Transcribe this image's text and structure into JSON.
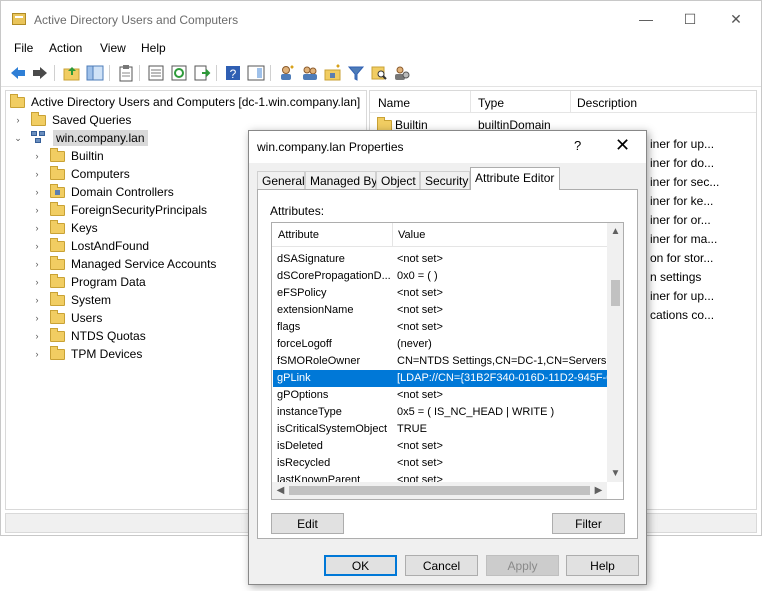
{
  "window": {
    "title": "Active Directory Users and Computers",
    "minimize": "—",
    "maximize": "☐",
    "close": "✕"
  },
  "menu": [
    "File",
    "Action",
    "View",
    "Help"
  ],
  "tree": {
    "root": "Active Directory Users and Computers [dc-1.win.company.lan]",
    "saved_queries": "Saved Queries",
    "domain": "win.company.lan",
    "children": [
      "Builtin",
      "Computers",
      "Domain Controllers",
      "ForeignSecurityPrincipals",
      "Keys",
      "LostAndFound",
      "Managed Service Accounts",
      "Program Data",
      "System",
      "Users",
      "NTDS Quotas",
      "TPM Devices"
    ]
  },
  "list": {
    "columns": [
      "Name",
      "Type",
      "Description"
    ],
    "first_row": {
      "name": "Builtin",
      "type": "builtinDomain"
    },
    "descriptions": [
      "iner for up...",
      "iner for do...",
      "iner for sec...",
      "iner for ke...",
      "iner for or...",
      "iner for ma...",
      "on for stor...",
      "n settings",
      "iner for up...",
      "cations co..."
    ]
  },
  "dialog": {
    "title": "win.company.lan Properties",
    "help": "?",
    "close": "✕",
    "tabs": [
      "General",
      "Managed By",
      "Object",
      "Security",
      "Attribute Editor"
    ],
    "attributes_label": "Attributes:",
    "columns": [
      "Attribute",
      "Value"
    ],
    "rows": [
      {
        "attr": "dSASignature",
        "value": "<not set>"
      },
      {
        "attr": "dSCorePropagationD...",
        "value": "0x0 = ( )"
      },
      {
        "attr": "eFSPolicy",
        "value": "<not set>"
      },
      {
        "attr": "extensionName",
        "value": "<not set>"
      },
      {
        "attr": "flags",
        "value": "<not set>"
      },
      {
        "attr": "forceLogoff",
        "value": "(never)"
      },
      {
        "attr": "fSMORoleOwner",
        "value": "CN=NTDS Settings,CN=DC-1,CN=Servers,C"
      },
      {
        "attr": "gPLink",
        "value": "[LDAP://CN={31B2F340-016D-11D2-945F-0"
      },
      {
        "attr": "gPOptions",
        "value": "<not set>"
      },
      {
        "attr": "instanceType",
        "value": "0x5 = ( IS_NC_HEAD | WRITE )"
      },
      {
        "attr": "isCriticalSystemObject",
        "value": "TRUE"
      },
      {
        "attr": "isDeleted",
        "value": "<not set>"
      },
      {
        "attr": "isRecycled",
        "value": "<not set>"
      },
      {
        "attr": "lastKnownParent",
        "value": "<not set>"
      }
    ],
    "selected_row": "gPLink",
    "edit_button": "Edit",
    "filter_button": "Filter",
    "ok_button": "OK",
    "cancel_button": "Cancel",
    "apply_button": "Apply",
    "help_button": "Help"
  },
  "colors": {
    "selection": "#0078d7",
    "folder": "#f1cd62"
  }
}
